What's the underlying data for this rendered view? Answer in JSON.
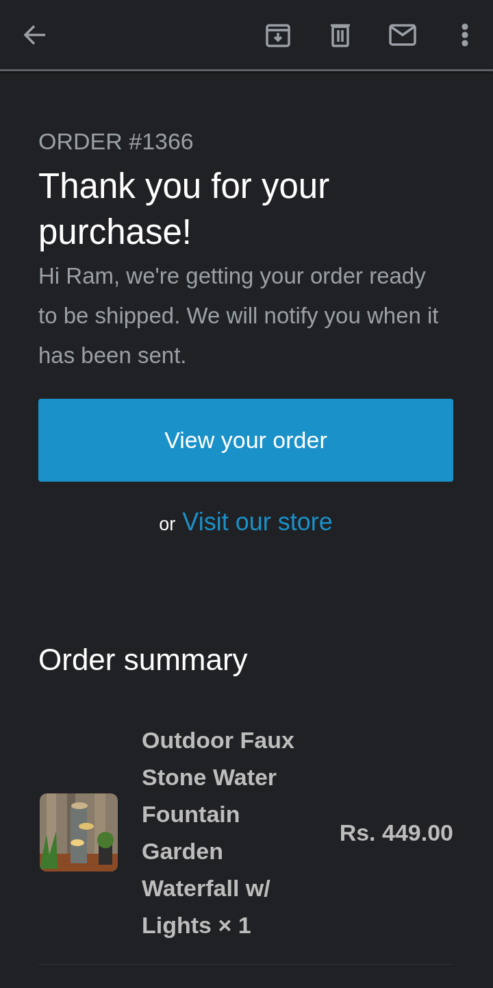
{
  "email": {
    "order_number": "ORDER #1366",
    "title": "Thank you for your purchase!",
    "message": "Hi Ram, we're getting your order ready to be shipped. We will notify you when it has been sent.",
    "button": "View your order",
    "alt_prefix": "or",
    "alt_link": "Visit our store"
  },
  "order_summary": {
    "heading": "Order summary",
    "items": [
      {
        "name": "Outdoor Faux Stone Water Fountain Garden Waterfall w/ Lights × 1",
        "price": "Rs. 449.00"
      }
    ]
  }
}
